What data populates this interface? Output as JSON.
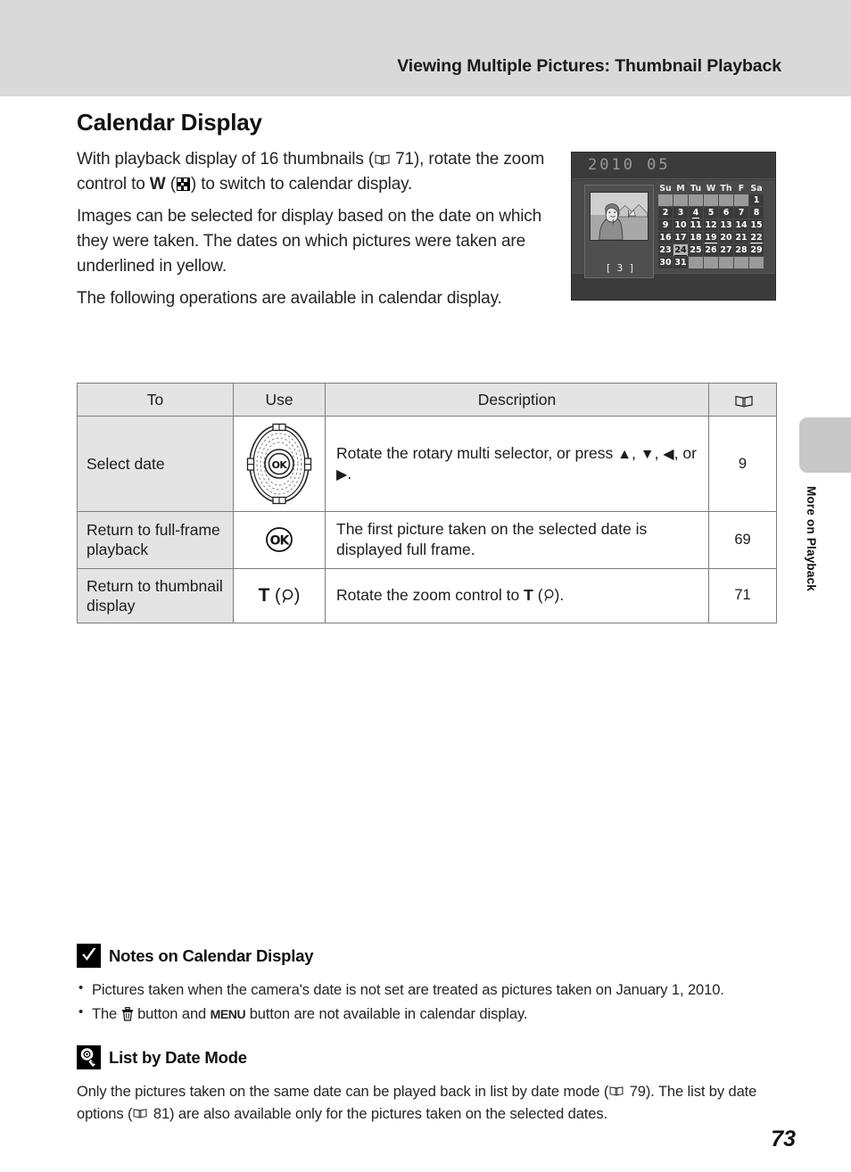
{
  "header": {
    "title": "Viewing Multiple Pictures: Thumbnail Playback"
  },
  "side_tab": {
    "label": "More on Playback"
  },
  "page": {
    "number": "73"
  },
  "section": {
    "title": "Calendar Display",
    "paragraphs": [
      {
        "part1": "With playback display of 16 thumbnails (",
        "ref1": "71",
        "part2": "), rotate the zoom control to ",
        "w": "W",
        "part3": " (",
        "part4": ") to switch to calendar display."
      },
      {
        "text": "Images can be selected for display based on the date on which they were taken. The dates on which pictures were taken are underlined in yellow."
      },
      {
        "text": "The following operations are available in calendar display."
      }
    ]
  },
  "calendar_screen": {
    "year_month": "2010  05",
    "weekday_headers": [
      "Su",
      "M",
      "Tu",
      "W",
      "Th",
      "F",
      "Sa"
    ],
    "image_count": "[    3 ]",
    "selected_day": 24,
    "underlined_days": [
      4,
      19,
      22,
      24
    ],
    "weeks": [
      [
        "",
        "",
        "",
        "",
        "",
        "",
        "1"
      ],
      [
        "2",
        "3",
        "4",
        "5",
        "6",
        "7",
        "8"
      ],
      [
        "9",
        "10",
        "11",
        "12",
        "13",
        "14",
        "15"
      ],
      [
        "16",
        "17",
        "18",
        "19",
        "20",
        "21",
        "22"
      ],
      [
        "23",
        "24",
        "25",
        "26",
        "27",
        "28",
        "29"
      ],
      [
        "30",
        "31",
        "",
        "",
        "",
        "",
        ""
      ]
    ]
  },
  "op_table": {
    "headers": {
      "to": "To",
      "use": "Use",
      "description": "Description",
      "ref": "book-icon"
    },
    "rows": [
      {
        "to": "Select date",
        "use_icon": "rotary-multi-selector",
        "use_label": "OK",
        "desc_part1": "Rotate the rotary multi selector, or press ",
        "desc_up": "▲",
        "desc_sep1": ", ",
        "desc_down": "▼",
        "desc_sep2": ", ",
        "desc_left": "◀",
        "desc_sep3": ", or ",
        "desc_right": "▶",
        "desc_end": ".",
        "ref": "9"
      },
      {
        "to": "Return to full-frame playback",
        "use_icon": "ok-button",
        "use_label": "OK",
        "desc": "The first picture taken on the selected date is displayed full frame.",
        "ref": "69"
      },
      {
        "to": "Return to thumbnail display",
        "use_icon": "zoom-tele-button",
        "use_label": "T",
        "desc_part1": "Rotate the zoom control to ",
        "desc_t": "T",
        "desc_part2": " (",
        "desc_part3": ").",
        "ref": "71"
      }
    ]
  },
  "notes": [
    {
      "badge": "checkmark-icon",
      "title": "Notes on Calendar Display",
      "items": [
        "Pictures taken when the camera's date is not set are treated as pictures taken on January 1, 2010.",
        {
          "part1": "The ",
          "glyph1": "trash-icon",
          "part2": " button and ",
          "glyph2": "MENU",
          "part3": " button are not available in calendar display."
        }
      ]
    },
    {
      "badge": "lightbulb-icon",
      "title": "List by Date Mode",
      "paragraph": {
        "part1": "Only the pictures taken on the same date can be played back in list by date mode (",
        "ref1": "79",
        "part2": "). The list by date options (",
        "ref2": "81",
        "part3": ") are also available only for the pictures taken on the selected dates."
      }
    }
  ],
  "colors": {
    "header_band": "#d9d9d9",
    "side_tab": "#c8c8c8",
    "table_header": "#e4e4e4",
    "table_border": "#7d7d7d",
    "screen_bg": "#3b3b3b",
    "calendar_body": "#4a4a4a"
  }
}
